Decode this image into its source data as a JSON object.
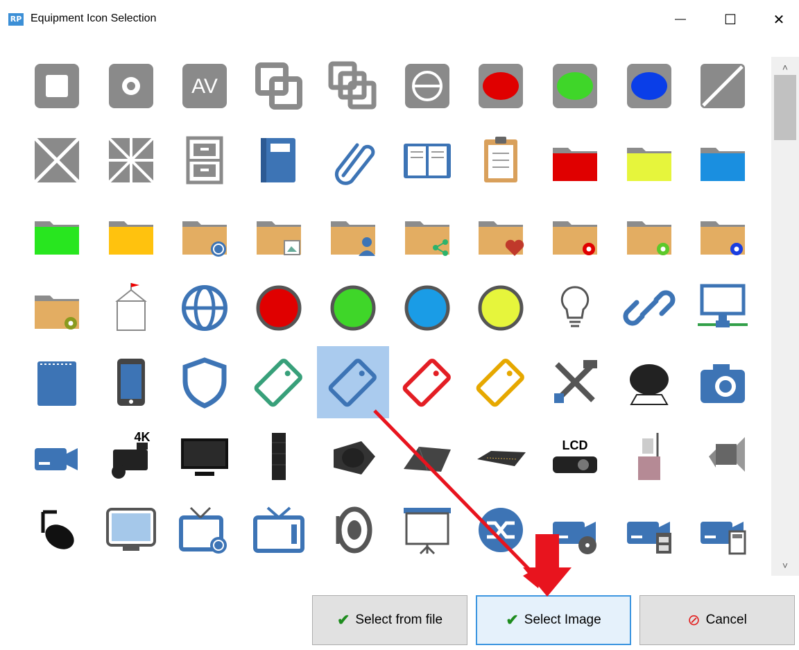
{
  "window": {
    "logo_text": "RP",
    "title": "Equipment Icon Selection",
    "minimize_symbol": "—",
    "maximize_symbol": "☐",
    "close_symbol": "✕"
  },
  "icons": [
    "square-icon",
    "circle-dot-icon",
    "av-icon",
    "overlap-squares-icon",
    "stacked-squares-icon",
    "circle-minus-icon",
    "red-oval-icon",
    "green-oval-icon",
    "blue-oval-icon",
    "diagonal-slash-icon",
    "x-cross-icon",
    "star-cross-icon",
    "filing-cabinet-icon",
    "blue-book-icon",
    "paperclip-icon",
    "open-book-icon",
    "clipboard-icon",
    "red-folder-icon",
    "yellow-folder-icon",
    "blue-folder-icon",
    "green-folder-icon",
    "orange-folder-icon",
    "folder-globe-icon",
    "folder-image-icon",
    "folder-user-icon",
    "folder-share-icon",
    "folder-heart-icon",
    "folder-red-gear-icon",
    "folder-green-gear-icon",
    "folder-blue-gear-icon",
    "folder-gear-icon",
    "flag-box-icon",
    "globe-icon",
    "red-circle-icon",
    "green-circle-icon",
    "blue-circle-icon",
    "yellow-circle-icon",
    "lightbulb-icon",
    "chain-link-icon",
    "network-monitor-icon",
    "notepad-icon",
    "tablet-icon",
    "shield-icon",
    "green-tag-icon",
    "blue-tag-icon",
    "red-tag-icon",
    "yellow-tag-icon",
    "tools-icon",
    "microphone-windscreen-icon",
    "camera-icon",
    "video-camera-icon",
    "4k-camcorder-icon",
    "tv-monitor-icon",
    "line-array-speaker-icon",
    "stage-monitor-speaker-icon",
    "mixing-console-icon",
    "audio-mixer-icon",
    "lcd-projector-icon",
    "overhead-projector-icon",
    "stage-light-icon",
    "spotlight-icon",
    "monitor-icon",
    "tv-globe-icon",
    "tv-icon",
    "loudspeaker-icon",
    "projection-screen-icon",
    "shuffle-icon",
    "camera-reel-icon",
    "camera-film-icon",
    "camera-remote-icon"
  ],
  "selected_index": 44,
  "icon_texts": {
    "av": "AV",
    "4k": "4K",
    "lcd": "LCD"
  },
  "buttons": {
    "select_file": "Select from file",
    "select_image": "Select Image",
    "cancel": "Cancel",
    "check_symbol": "✔",
    "cancel_symbol": "⊘"
  },
  "scrollbar": {
    "up": "˄",
    "down": "˅"
  },
  "colors": {
    "gray": "#8a8a8a",
    "blue": "#3d74b5",
    "red": "#e00000",
    "green": "#3fd629",
    "brightblue": "#0a3ee8",
    "folder": "#e3ad62",
    "folderTab": "#8c8c8c",
    "selection": "#aacbee",
    "arrow": "#e8141e"
  }
}
